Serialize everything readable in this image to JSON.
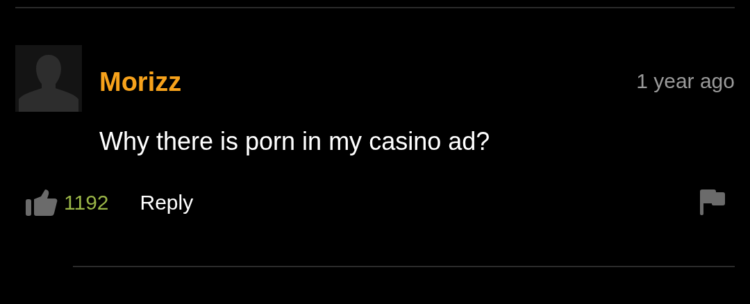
{
  "comment": {
    "author": "Morizz",
    "time": "1 year ago",
    "text": "Why there is porn in my casino ad?",
    "likes": "1192",
    "reply_label": "Reply"
  }
}
